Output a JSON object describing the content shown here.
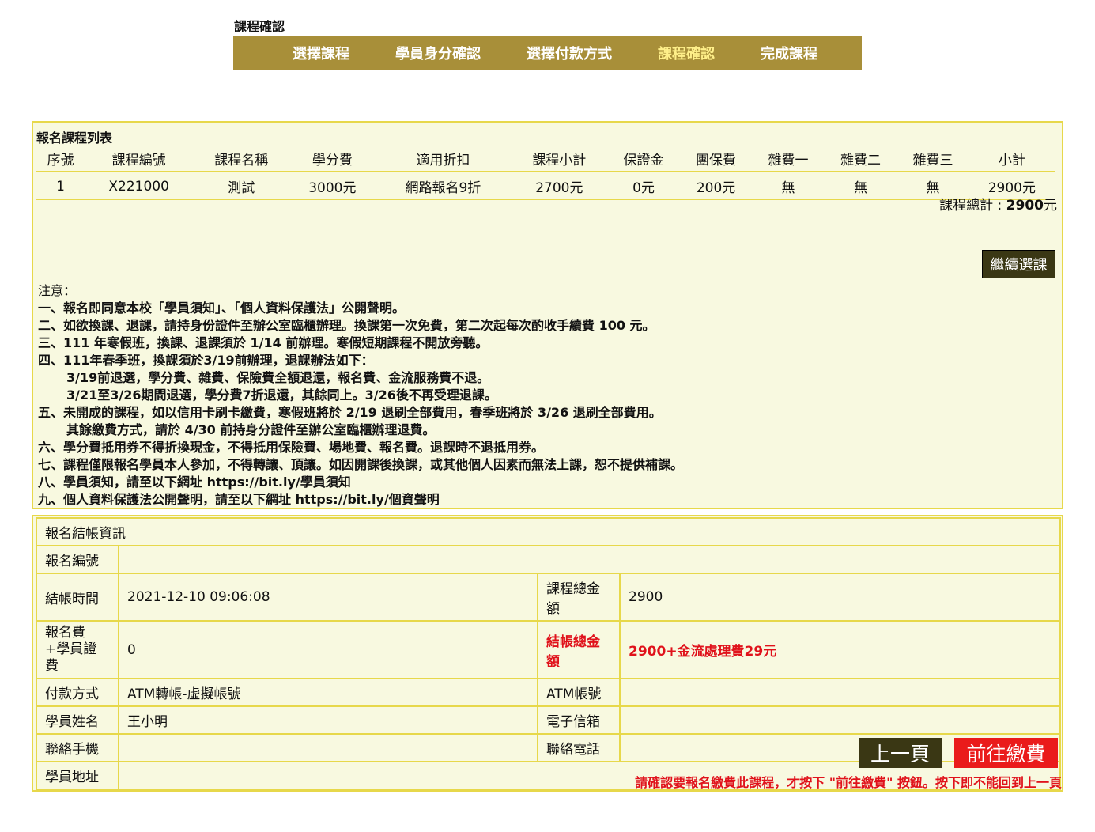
{
  "heading": "課程確認",
  "steps": [
    "選擇課程",
    "學員身分確認",
    "選擇付款方式",
    "課程確認",
    "完成課程"
  ],
  "course_list": {
    "title": "報名課程列表",
    "headers": [
      "序號",
      "課程編號",
      "課程名稱",
      "學分費",
      "適用折扣",
      "課程小計",
      "保證金",
      "團保費",
      "雜費一",
      "雜費二",
      "雜費三",
      "小計"
    ],
    "rows": [
      [
        "1",
        "X221000",
        "測試",
        "3000元",
        "網路報名9折",
        "2700元",
        "0元",
        "200元",
        "無",
        "無",
        "無",
        "2900元"
      ]
    ],
    "total_label": "課程總計 : ",
    "total_value": "2900",
    "total_unit": "元",
    "continue_button": "繼續選課"
  },
  "notes": {
    "head": "注意：",
    "lines": [
      "一、報名即同意本校「學員須知」、「個人資料保護法」公開聲明。",
      "二、如欲換課、退課，請持身份證件至辦公室臨櫃辦理。換課第一次免費，第二次起每次酌收手續費 100 元。",
      "三、111 年寒假班，換課、退課須於 1/14 前辦理。寒假短期課程不開放旁聽。",
      "四、111年春季班，換課須於3/19前辦理，退課辦法如下：",
      "3/19前退選，學分費、雜費、保險費全額退還，報名費、金流服務費不退。",
      "3/21至3/26期間退選，學分費7折退還，其餘同上。3/26後不再受理退課。",
      "五、未開成的課程，如以信用卡刷卡繳費，寒假班將於 2/19 退刷全部費用，春季班將於 3/26 退刷全部費用。",
      "其餘繳費方式，請於 4/30 前持身分證件至辦公室臨櫃辦理退費。",
      "六、學分費抵用券不得折換現金，不得抵用保險費、場地費、報名費。退課時不退抵用券。",
      "七、課程僅限報名學員本人參加，不得轉讓、頂讓。如因開課後換課，或其他個人因素而無法上課，恕不提供補課。",
      "八、學員須知，請至以下網址 https://bit.ly/學員須知",
      "九、個人資料保護法公開聲明，請至以下網址 https://bit.ly/個資聲明"
    ]
  },
  "checkout": {
    "title": "報名結帳資訊",
    "reg_no_label": "報名編號",
    "reg_no_value": "",
    "time_label": "結帳時間",
    "time_value": "2021-12-10 09:06:08",
    "course_total_label": "課程總金額",
    "course_total_value": "2900",
    "fee_label": "報名費+學員證費",
    "fee_value": "0",
    "grand_total_label": "結帳總金額",
    "grand_total_value": "2900+金流處理費29元",
    "payment_label": "付款方式",
    "payment_value": "ATM轉帳-虛擬帳號",
    "atm_label": "ATM帳號",
    "atm_value": "",
    "name_label": "學員姓名",
    "name_value": "王小明",
    "email_label": "電子信箱",
    "email_value": "",
    "mobile_label": "聯絡手機",
    "mobile_value": "",
    "phone_label": "聯絡電話",
    "phone_value": "",
    "address_label": "學員地址",
    "address_value": ""
  },
  "buttons": {
    "prev": "上一頁",
    "pay": "前往繳費"
  },
  "warning": "請確認要報名繳費此課程，才按下 \"前往繳費\" 按鈕。按下即不能回到上一頁",
  "colors": {
    "accent": "#a88f39",
    "active_step": "#fff08a",
    "panel_bg": "#f8f9e0",
    "panel_border": "#e7d84b",
    "dark_button": "#3a3714",
    "red": "#e0121b"
  }
}
